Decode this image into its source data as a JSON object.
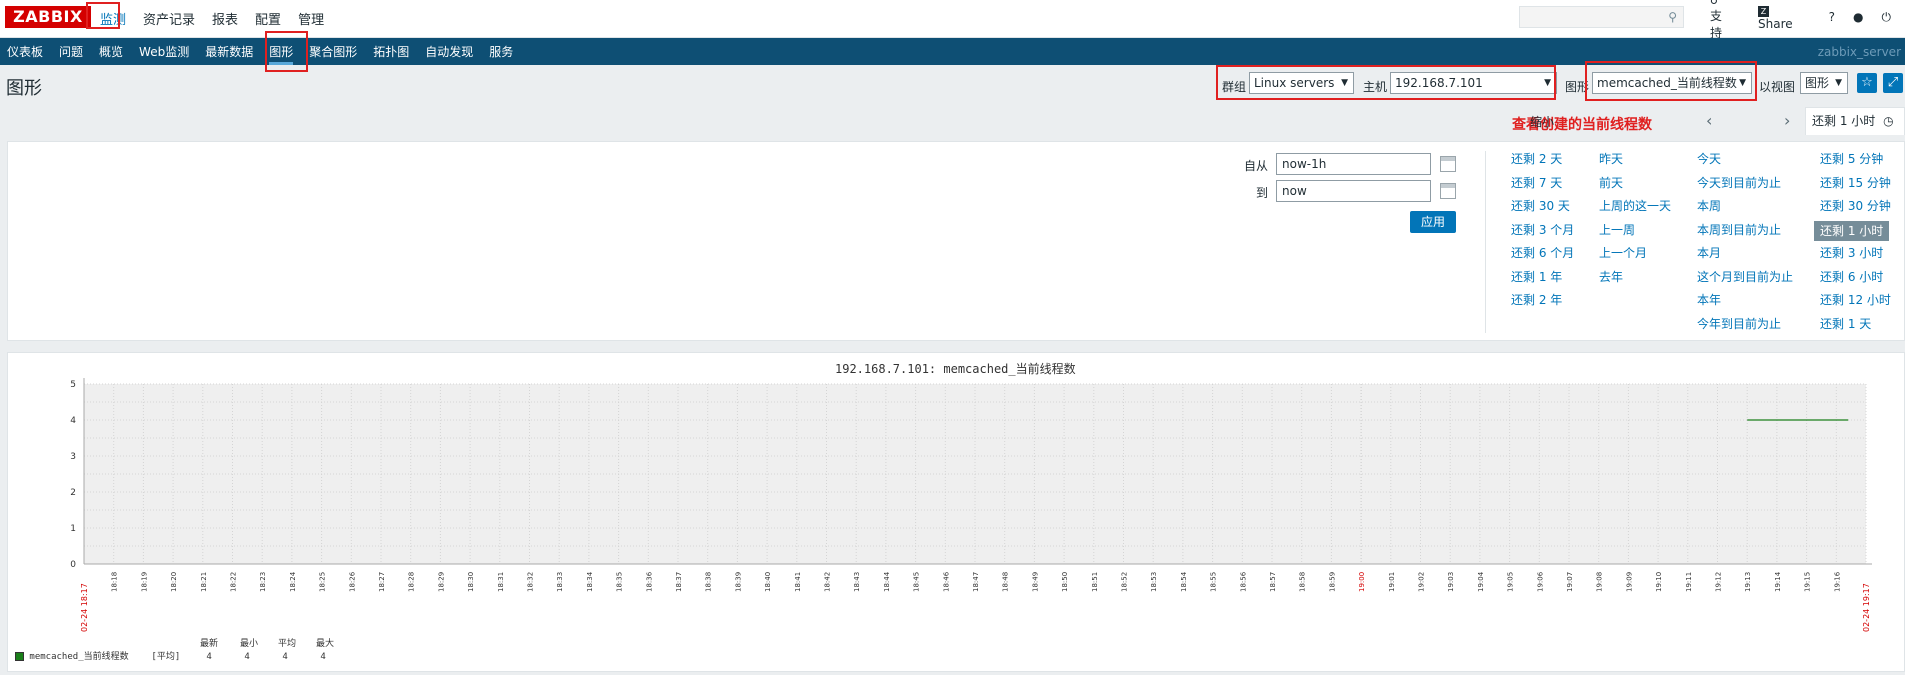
{
  "brand": "ZABBIX",
  "topmenu": [
    "监测",
    "资产记录",
    "报表",
    "配置",
    "管理"
  ],
  "toplinks": {
    "support": "支持",
    "share": "Share",
    "help": "?",
    "user": "user",
    "power": "power"
  },
  "subnav": [
    "仪表板",
    "问题",
    "概览",
    "Web监测",
    "最新数据",
    "图形",
    "聚合图形",
    "拓扑图",
    "自动发现",
    "服务"
  ],
  "server_name": "zabbix_server",
  "page_title": "图形",
  "filters": {
    "group_label": "群组",
    "group_value": "Linux servers",
    "host_label": "主机",
    "host_value": "192.168.7.101",
    "graph_label": "图形",
    "graph_value": "memcached_当前线程数",
    "view_label": "以视图",
    "view_value": "图形"
  },
  "annotation": "查看创建的当前线程数",
  "zoom_label": "缩小",
  "time_tab": "还剩 1 小时",
  "time_from_label": "自从",
  "time_from": "now-1h",
  "time_to_label": "到",
  "time_to": "now",
  "apply_label": "应用",
  "quick_ranges": [
    [
      "还剩 2 天",
      "还剩 7 天",
      "还剩 30 天",
      "还剩 3 个月",
      "还剩 6 个月",
      "还剩 1 年",
      "还剩 2 年"
    ],
    [
      "昨天",
      "前天",
      "上周的这一天",
      "上一周",
      "上一个月",
      "去年"
    ],
    [
      "今天",
      "今天到目前为止",
      "本周",
      "本周到目前为止",
      "本月",
      "这个月到目前为止",
      "本年",
      "今年到目前为止"
    ],
    [
      "还剩 5 分钟",
      "还剩 15 分钟",
      "还剩 30 分钟",
      "还剩 1 小时",
      "还剩 3 小时",
      "还剩 6 小时",
      "还剩 12 小时",
      "还剩 1 天"
    ]
  ],
  "selected_range": "还剩 1 小时",
  "chart_data": {
    "type": "line",
    "title": "192.168.7.101: memcached_当前线程数",
    "ylim": [
      0,
      5
    ],
    "yticks": [
      0,
      1,
      2,
      3,
      4,
      5
    ],
    "x_start_label": "02-24 18:17",
    "x_end_label": "02-24 19:17",
    "x_ticks": [
      "18:18",
      "18:19",
      "18:20",
      "18:21",
      "18:22",
      "18:23",
      "18:24",
      "18:25",
      "18:26",
      "18:27",
      "18:28",
      "18:29",
      "18:30",
      "18:31",
      "18:32",
      "18:33",
      "18:34",
      "18:35",
      "18:36",
      "18:37",
      "18:38",
      "18:39",
      "18:40",
      "18:41",
      "18:42",
      "18:43",
      "18:44",
      "18:45",
      "18:46",
      "18:47",
      "18:48",
      "18:49",
      "18:50",
      "18:51",
      "18:52",
      "18:53",
      "18:54",
      "18:55",
      "18:56",
      "18:57",
      "18:58",
      "18:59",
      "19:00",
      "19:01",
      "19:02",
      "19:03",
      "19:04",
      "19:05",
      "19:06",
      "19:07",
      "19:08",
      "19:09",
      "19:10",
      "19:11",
      "19:12",
      "19:13",
      "19:14",
      "19:15",
      "19:16"
    ],
    "series": [
      {
        "name": "memcached_当前线程数",
        "color": "#1a7f1a",
        "x_start_minutes": 56,
        "x_end_minutes": 59.4,
        "value": 4
      }
    ],
    "legend": {
      "headers": [
        "最新",
        "最小",
        "平均",
        "最大"
      ],
      "func": "[平均]",
      "values": [
        "4",
        "4",
        "4",
        "4"
      ]
    }
  }
}
